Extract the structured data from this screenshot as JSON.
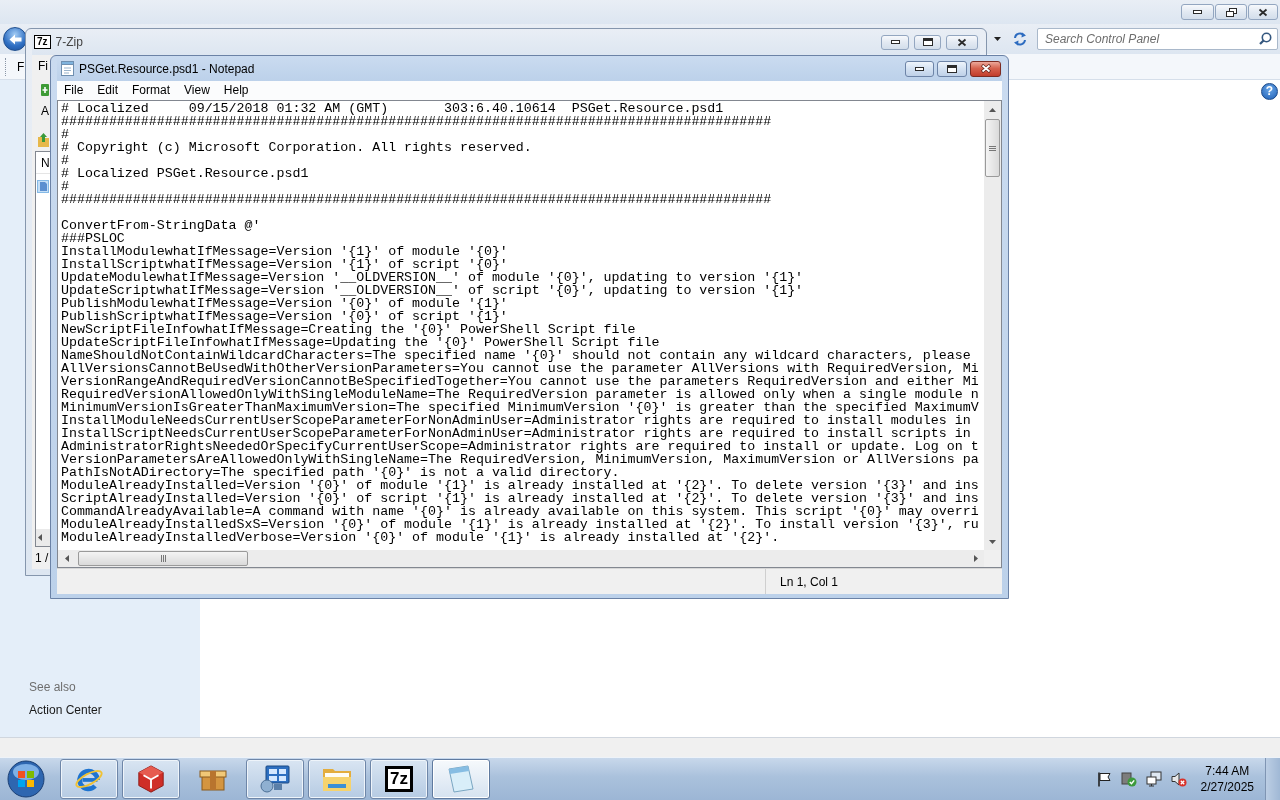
{
  "control_panel": {
    "active": false,
    "search": {
      "placeholder": "Search Control Panel"
    },
    "menu": [
      "F"
    ],
    "help": "?",
    "see_also": {
      "heading": "See also",
      "links": [
        "Action Center"
      ]
    }
  },
  "seven_zip": {
    "active": false,
    "logo": "7z",
    "title": "7-Zip",
    "menu": [
      "Fi"
    ],
    "toolbar": [
      "A"
    ],
    "columns": [
      "N"
    ],
    "rows": [
      {
        "selected": true
      }
    ],
    "status": "1 /"
  },
  "notepad": {
    "active": true,
    "title": "PSGet.Resource.psd1 - Notepad",
    "menu": [
      "File",
      "Edit",
      "Format",
      "View",
      "Help"
    ],
    "header_lines": [
      "# Localized     09/15/2018 01:32 AM (GMT)       303:6.40.10614  PSGet.Resource.psd1",
      "#########################################################################################",
      "#",
      "# Copyright (c) Microsoft Corporation. All rights reserved.",
      "#",
      "# Localized PSGet.Resource.psd1",
      "#",
      "#########################################################################################"
    ],
    "body_lines": [
      "ConvertFrom-StringData @'",
      "###PSLOC",
      "InstallModulewhatIfMessage=Version '{1}' of module '{0}'",
      "InstallScriptwhatIfMessage=Version '{1}' of script '{0}'",
      "UpdateModulewhatIfMessage=Version '__OLDVERSION__' of module '{0}', updating to version '{1}'",
      "UpdateScriptwhatIfMessage=Version '__OLDVERSION__' of script '{0}', updating to version '{1}'",
      "PublishModulewhatIfMessage=Version '{0}' of module '{1}'",
      "PublishScriptwhatIfMessage=Version '{0}' of script '{1}'",
      "NewScriptFileInfowhatIfMessage=Creating the '{0}' PowerShell Script file",
      "UpdateScriptFileInfowhatIfMessage=Updating the '{0}' PowerShell Script file",
      "NameShouldNotContainWildcardCharacters=The specified name '{0}' should not contain any wildcard characters, please",
      "AllVersionsCannotBeUsedWithOtherVersionParameters=You cannot use the parameter AllVersions with RequiredVersion, Mi",
      "VersionRangeAndRequiredVersionCannotBeSpecifiedTogether=You cannot use the parameters RequiredVersion and either Mi",
      "RequiredVersionAllowedOnlyWithSingleModuleName=The RequiredVersion parameter is allowed only when a single module n",
      "MinimumVersionIsGreaterThanMaximumVersion=The specified MinimumVersion '{0}' is greater than the specified MaximumV",
      "InstallModuleNeedsCurrentUserScopeParameterForNonAdminUser=Administrator rights are required to install modules in",
      "InstallScriptNeedsCurrentUserScopeParameterForNonAdminUser=Administrator rights are required to install scripts in",
      "AdministratorRightsNeededOrSpecifyCurrentUserScope=Administrator rights are required to install or update. Log on t",
      "VersionParametersAreAllowedOnlyWithSingleName=The RequiredVersion, MinimumVersion, MaximumVersion or AllVersions pa",
      "PathIsNotADirectory=The specified path '{0}' is not a valid directory.",
      "ModuleAlreadyInstalled=Version '{0}' of module '{1}' is already installed at '{2}'. To delete version '{3}' and ins",
      "ScriptAlreadyInstalled=Version '{0}' of script '{1}' is already installed at '{2}'. To delete version '{3}' and ins",
      "CommandAlreadyAvailable=A command with name '{0}' is already available on this system. This script '{0}' may overri",
      "ModuleAlreadyInstalledSxS=Version '{0}' of module '{1}' is already installed at '{2}'. To install version '{3}', ru",
      "ModuleAlreadyInstalledVerbose=Version '{0}' of module '{1}' is already installed at '{2}'."
    ],
    "status": "Ln 1, Col 1"
  },
  "taskbar": {
    "items": [
      {
        "kind": "browser",
        "running": true,
        "active": false
      },
      {
        "kind": "cube",
        "running": true,
        "active": false
      },
      {
        "kind": "box",
        "running": false,
        "active": false
      },
      {
        "kind": "control-panel",
        "running": true,
        "active": false
      },
      {
        "kind": "folder",
        "running": true,
        "active": false
      },
      {
        "kind": "archiver",
        "logo": "7z",
        "running": true,
        "active": false
      },
      {
        "kind": "notepad",
        "running": true,
        "active": true
      }
    ],
    "clock": {
      "time": "7:44 AM",
      "date": "2/27/2025"
    }
  }
}
